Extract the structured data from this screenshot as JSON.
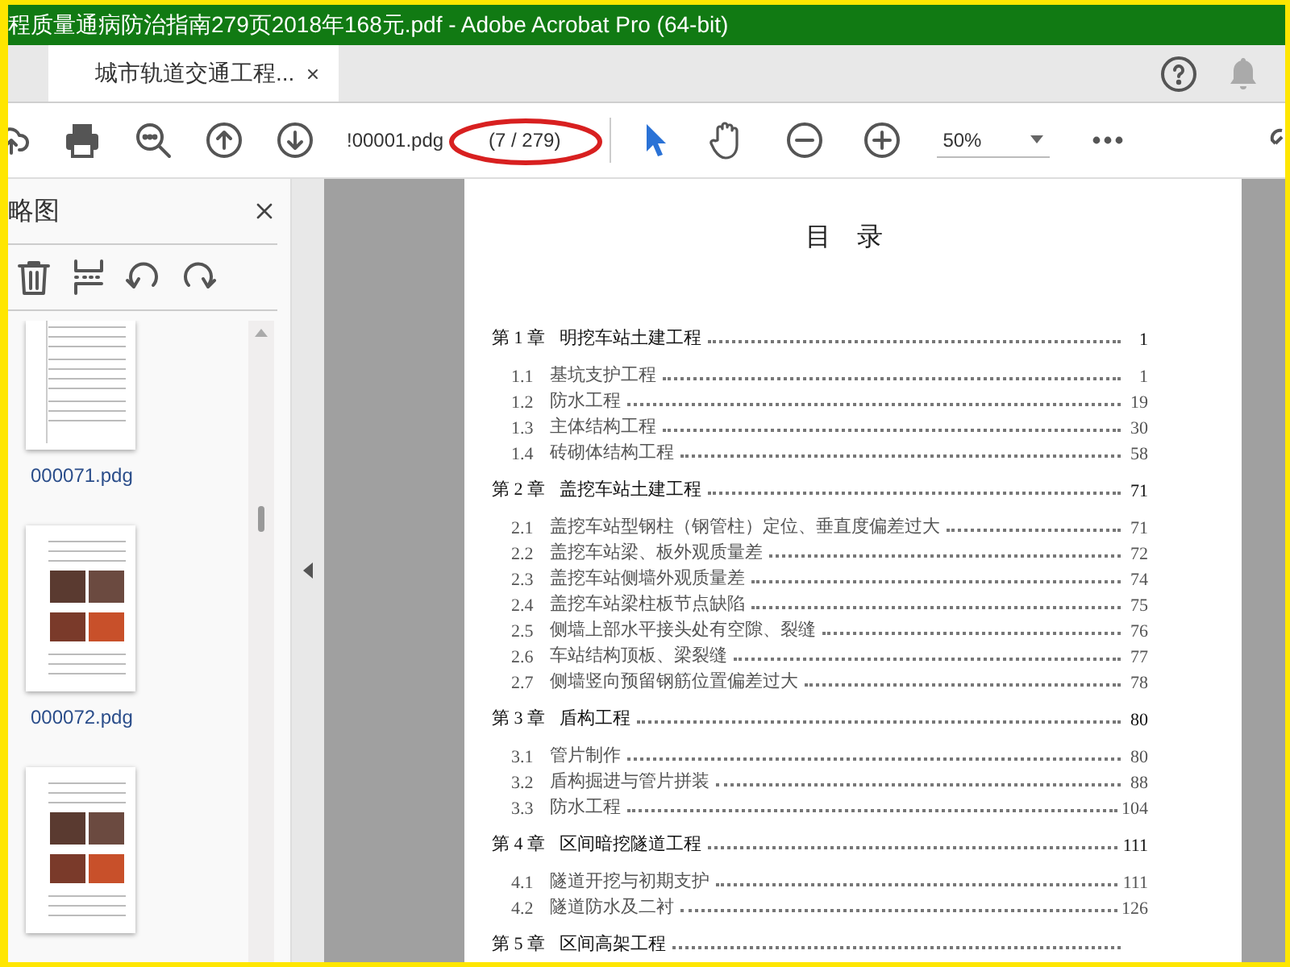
{
  "window": {
    "title": "程质量通病防治指南279页2018年168元.pdf - Adobe Acrobat Pro (64-bit)"
  },
  "tabs": [
    {
      "label": "城市轨道交通工程...",
      "selected": true
    }
  ],
  "toolbar": {
    "page_field": {
      "value": "!00001.pdg"
    },
    "page_count": "(7 / 279)",
    "tools": [
      {
        "kind": "select",
        "selected": true
      },
      {
        "kind": "hand",
        "selected": false
      }
    ],
    "zoom": "50%"
  },
  "sidebar": {
    "title": "略图",
    "thumbnails": [
      {
        "kind": "text",
        "label": "000071.pdg"
      },
      {
        "kind": "photos",
        "label": "000072.pdg"
      },
      {
        "kind": "photos"
      }
    ]
  },
  "document": {
    "heading": "目　录",
    "toc": [
      {
        "number": "第 1 章",
        "title": "明挖车站土建工程",
        "page": "1",
        "children": [
          {
            "number": "1.1",
            "title": "基坑支护工程",
            "page": "1"
          },
          {
            "number": "1.2",
            "title": "防水工程",
            "page": "19"
          },
          {
            "number": "1.3",
            "title": "主体结构工程",
            "page": "30"
          },
          {
            "number": "1.4",
            "title": "砖砌体结构工程",
            "page": "58"
          }
        ]
      },
      {
        "number": "第 2 章",
        "title": "盖挖车站土建工程",
        "page": "71",
        "children": [
          {
            "number": "2.1",
            "title": "盖挖车站型钢柱（钢管柱）定位、垂直度偏差过大",
            "page": "71"
          },
          {
            "number": "2.2",
            "title": "盖挖车站梁、板外观质量差",
            "page": "72"
          },
          {
            "number": "2.3",
            "title": "盖挖车站侧墙外观质量差",
            "page": "74"
          },
          {
            "number": "2.4",
            "title": "盖挖车站梁柱板节点缺陷",
            "page": "75"
          },
          {
            "number": "2.5",
            "title": "侧墙上部水平接头处有空隙、裂缝",
            "page": "76"
          },
          {
            "number": "2.6",
            "title": "车站结构顶板、梁裂缝",
            "page": "77"
          },
          {
            "number": "2.7",
            "title": "侧墙竖向预留钢筋位置偏差过大",
            "page": "78"
          }
        ]
      },
      {
        "number": "第 3 章",
        "title": "盾构工程",
        "page": "80",
        "children": [
          {
            "number": "3.1",
            "title": "管片制作",
            "page": "80"
          },
          {
            "number": "3.2",
            "title": "盾构掘进与管片拼装",
            "page": "88"
          },
          {
            "number": "3.3",
            "title": "防水工程",
            "page": "104"
          }
        ]
      },
      {
        "number": "第 4 章",
        "title": "区间暗挖隧道工程",
        "page": "111",
        "children": [
          {
            "number": "4.1",
            "title": "隧道开挖与初期支护",
            "page": "111"
          },
          {
            "number": "4.2",
            "title": "隧道防水及二衬",
            "page": "126"
          }
        ]
      },
      {
        "number": "第 5 章",
        "title": "区间高架工程"
      }
    ]
  }
}
